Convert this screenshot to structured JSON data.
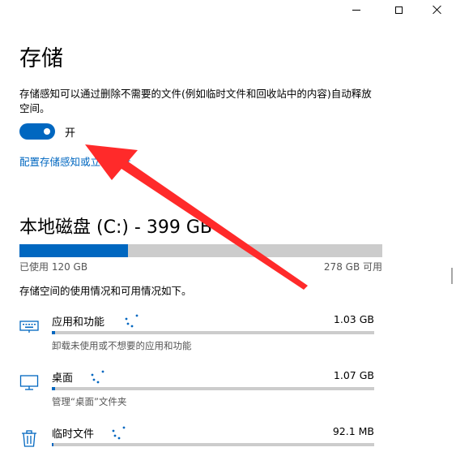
{
  "page": {
    "title": "存储",
    "description": "存储感知可以通过删除不需要的文件(例如临时文件和回收站中的内容)自动释放空间。",
    "toggle": {
      "state_label": "开",
      "on": true
    },
    "config_link": "配置存储感知或立即运行"
  },
  "disk": {
    "title": "本地磁盘 (C:) - 399 GB",
    "used_label": "已使用 120 GB",
    "free_label": "278 GB 可用",
    "used_fraction": 0.3,
    "breakdown_desc": "存储空间的使用情况和可用情况如下。"
  },
  "categories": [
    {
      "name": "应用和功能",
      "size": "1.03 GB",
      "sub": "卸载未使用或不想要的应用和功能",
      "icon": "keyboard-icon",
      "fill_fraction": 0.01
    },
    {
      "name": "桌面",
      "size": "1.07 GB",
      "sub": "管理“桌面”文件夹",
      "icon": "monitor-icon",
      "fill_fraction": 0.01
    },
    {
      "name": "临时文件",
      "size": "92.1 MB",
      "sub": "",
      "icon": "trash-icon",
      "fill_fraction": 0.0
    }
  ],
  "colors": {
    "accent": "#0067c0",
    "annotation": "#ff2a2a"
  }
}
